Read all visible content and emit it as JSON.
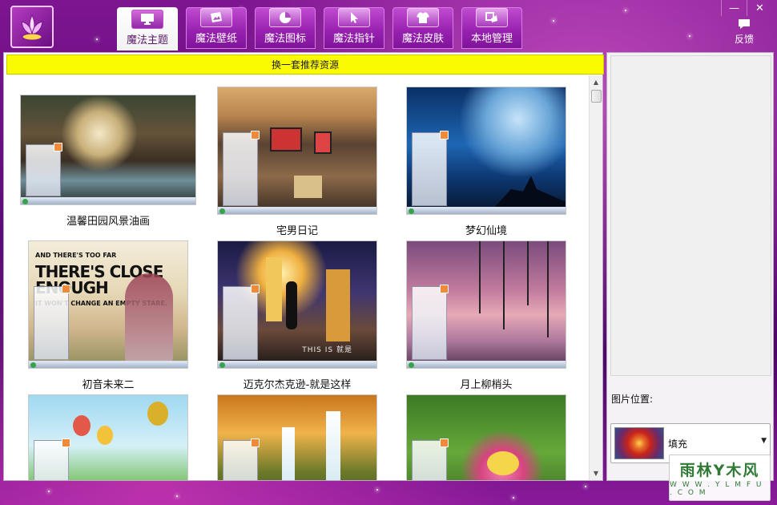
{
  "app": {
    "logo_icon": "lotus-logo-icon",
    "accent_color": "#9a22b1"
  },
  "tabs": [
    {
      "label": "魔法主题",
      "icon": "monitor-icon",
      "active": true
    },
    {
      "label": "魔法壁纸",
      "icon": "wallpaper-icon",
      "active": false
    },
    {
      "label": "魔法图标",
      "icon": "pie-icon",
      "active": false
    },
    {
      "label": "魔法指针",
      "icon": "cursor-icon",
      "active": false
    },
    {
      "label": "魔法皮肤",
      "icon": "shirt-icon",
      "active": false
    },
    {
      "label": "本地管理",
      "icon": "manage-icon",
      "active": false
    }
  ],
  "window_controls": {
    "minimize": "—",
    "close": "✕"
  },
  "feedback": {
    "label": "反馈",
    "icon": "chat-bubble-icon"
  },
  "banner": {
    "label": "换一套推荐资源",
    "color": "#fafa00"
  },
  "themes": [
    {
      "title": "温馨田园风景油画"
    },
    {
      "title": "宅男日记"
    },
    {
      "title": "梦幻仙境"
    },
    {
      "title": "初音未来二",
      "overlay_main": "THERE'S CLOSE ENOUGH",
      "overlay_top": "AND THERE'S TOO FAR",
      "overlay_sub": "IT WON'T CHANGE AN EMPTY STARE."
    },
    {
      "title": "迈克尔杰克逊-就是这样",
      "overlay_text": "THIS IS 就是"
    },
    {
      "title": "月上柳梢头"
    },
    {
      "title": ""
    },
    {
      "title": ""
    },
    {
      "title": ""
    }
  ],
  "side_panel": {
    "position_label": "图片位置:",
    "position_value": "填充",
    "dropdown_icon": "triangle-down-icon"
  },
  "watermark": {
    "main": "雨林Y木风",
    "sub": "W W W . Y L M F U . C O M"
  }
}
